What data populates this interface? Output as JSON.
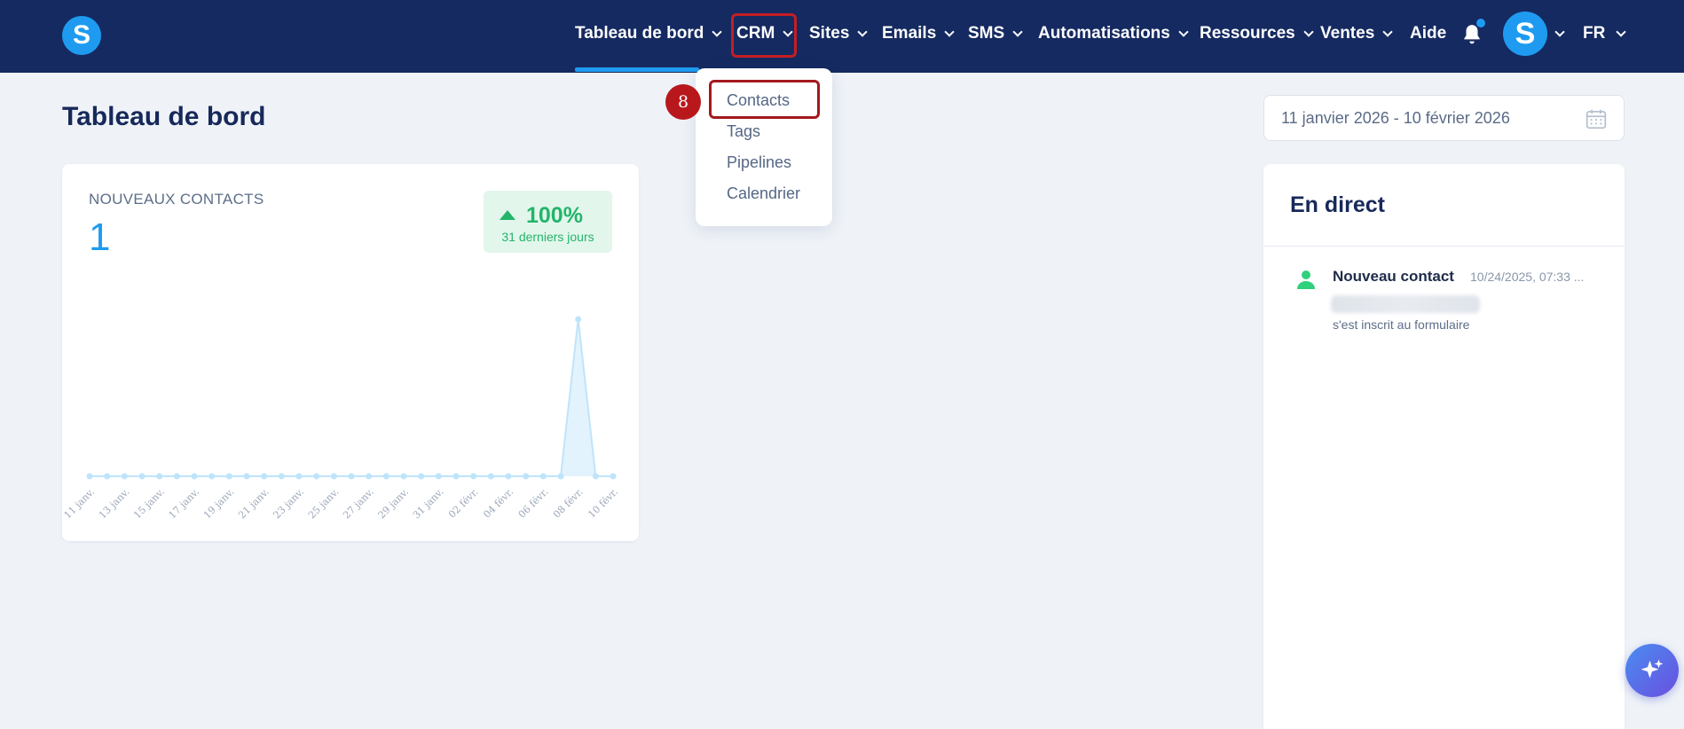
{
  "app": {
    "logo_letter": "S"
  },
  "nav": {
    "items": [
      {
        "label": "Tableau de bord",
        "has_dropdown": true,
        "active": true
      },
      {
        "label": "CRM",
        "has_dropdown": true
      },
      {
        "label": "Sites",
        "has_dropdown": true
      },
      {
        "label": "Emails",
        "has_dropdown": true
      },
      {
        "label": "SMS",
        "has_dropdown": true
      },
      {
        "label": "Automatisations",
        "has_dropdown": true
      },
      {
        "label": "Ressources",
        "has_dropdown": true
      },
      {
        "label": "Ventes",
        "has_dropdown": true
      },
      {
        "label": "Aide",
        "has_dropdown": false
      }
    ],
    "avatar_letter": "S",
    "language": "FR",
    "colors": {
      "background": "#152a61",
      "accent": "#1e9bf0"
    }
  },
  "crm_dropdown": {
    "items": [
      "Contacts",
      "Tags",
      "Pipelines",
      "Calendrier"
    ],
    "step_badge": "8"
  },
  "page": {
    "title": "Tableau de bord",
    "date_range": "11 janvier 2026 - 10 février 2026"
  },
  "contacts_card": {
    "label": "NOUVEAUX CONTACTS",
    "value": "1",
    "growth_pct": "100%",
    "growth_period": "31 derniers jours"
  },
  "chart_data": {
    "type": "area",
    "x_labels": [
      "11 janv.",
      "13 janv.",
      "15 janv.",
      "17 janv.",
      "19 janv.",
      "21 janv.",
      "23 janv.",
      "25 janv.",
      "27 janv.",
      "29 janv.",
      "31 janv.",
      "02 févr.",
      "04 févr.",
      "06 févr.",
      "08 févr.",
      "10 févr."
    ],
    "values": [
      0,
      0,
      0,
      0,
      0,
      0,
      0,
      0,
      0,
      0,
      0,
      0,
      0,
      0,
      0,
      0,
      0,
      0,
      0,
      0,
      0,
      0,
      0,
      0,
      0,
      0,
      0,
      0,
      1,
      0,
      0
    ],
    "ylim": [
      0,
      1
    ],
    "color": "#bfe4fa"
  },
  "live": {
    "title": "En direct",
    "entries": [
      {
        "name": "Nouveau contact",
        "time": "10/24/2025, 07:33 ...",
        "description": "s'est inscrit au formulaire"
      }
    ]
  }
}
